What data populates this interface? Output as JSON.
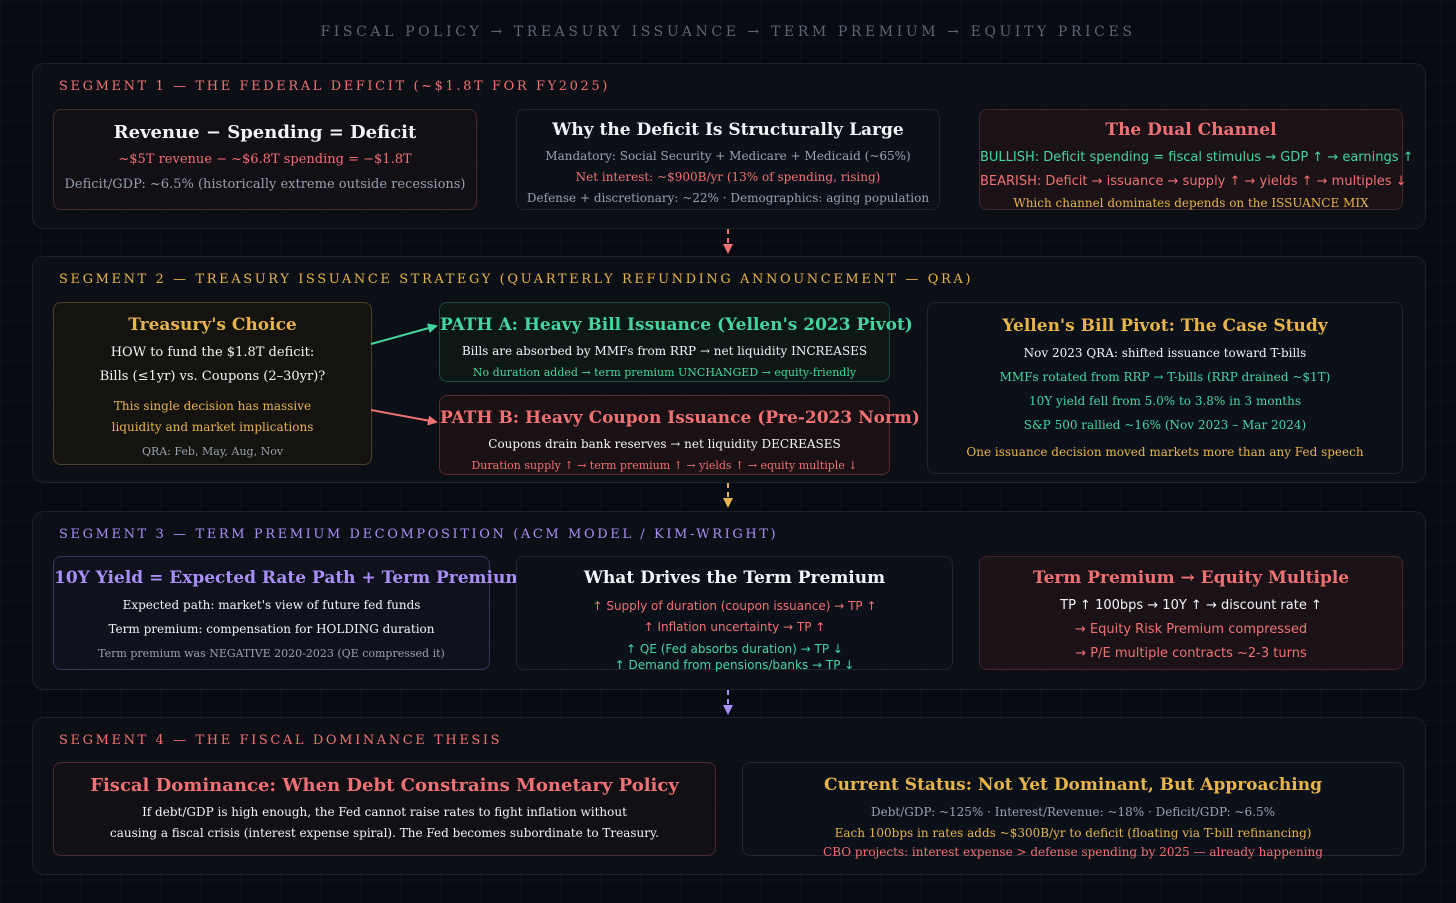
{
  "title": "FISCAL POLICY → TREASURY ISSUANCE → TERM PREMIUM → EQUITY PRICES",
  "colors": {
    "background": "#080b11",
    "red": "#f07174",
    "green": "#45d6a0",
    "gold": "#e7b44b",
    "purple": "#a98ff5",
    "gray": "#97a1af",
    "white": "#f2f4f7"
  },
  "segment1": {
    "label": "SEGMENT 1 — THE FEDERAL DEFICIT (~$1.8T FOR FY2025)",
    "equation": {
      "title": "Revenue − Spending = Deficit",
      "line1": "~$5T revenue − ~$6.8T spending = −$1.8T",
      "line2": "Deficit/GDP: ~6.5% (historically extreme outside recessions)"
    },
    "structural": {
      "title": "Why the Deficit Is Structurally Large",
      "line1": "Mandatory: Social Security + Medicare + Medicaid (~65%)",
      "line2": "Net interest: ~$900B/yr (13% of spending, rising)",
      "line3": "Defense + discretionary: ~22% · Demographics: aging population"
    },
    "dual": {
      "title": "The Dual Channel",
      "bullish": "BULLISH: Deficit spending = fiscal stimulus → GDP ↑ → earnings ↑",
      "bearish": "BEARISH: Deficit → issuance → supply ↑ → yields ↑ → multiples ↓",
      "note": "Which channel dominates depends on the ISSUANCE MIX"
    }
  },
  "segment2": {
    "label": "SEGMENT 2 — TREASURY ISSUANCE STRATEGY (QUARTERLY REFUNDING ANNOUNCEMENT — QRA)",
    "choice": {
      "title": "Treasury's Choice",
      "line1": "HOW to fund the $1.8T deficit:",
      "line2": "Bills (≤1yr) vs. Coupons (2–30yr)?",
      "line3": "This single decision has massive",
      "line4": "liquidity and market implications",
      "line5": "QRA: Feb, May, Aug, Nov"
    },
    "pathA": {
      "title": "PATH A: Heavy Bill Issuance (Yellen's 2023 Pivot)",
      "line1": "Bills are absorbed by MMFs from RRP → net liquidity INCREASES",
      "line2": "No duration added → term premium UNCHANGED → equity-friendly"
    },
    "pathB": {
      "title": "PATH B: Heavy Coupon Issuance (Pre-2023 Norm)",
      "line1": "Coupons drain bank reserves → net liquidity DECREASES",
      "line2": "Duration supply ↑ → term premium ↑ → yields ↑ → equity multiple ↓"
    },
    "case": {
      "title": "Yellen's Bill Pivot: The Case Study",
      "line1": "Nov 2023 QRA: shifted issuance toward T-bills",
      "line2": "MMFs rotated from RRP → T-bills (RRP drained ~$1T)",
      "line3": "10Y yield fell from 5.0% to 3.8% in 3 months",
      "line4": "S&P 500 rallied ~16% (Nov 2023 – Mar 2024)",
      "line5": "One issuance decision moved markets more than any Fed speech"
    }
  },
  "segment3": {
    "label": "SEGMENT 3 — TERM PREMIUM DECOMPOSITION (ACM MODEL / KIM-WRIGHT)",
    "yield": {
      "title": "10Y Yield = Expected Rate Path + Term Premium",
      "line1": "Expected path: market's view of future fed funds",
      "line2": "Term premium: compensation for HOLDING duration",
      "line3": "Term premium was NEGATIVE 2020-2023 (QE compressed it)"
    },
    "drivers": {
      "title": "What Drives the Term Premium",
      "line1": "↑ Supply of duration (coupon issuance) → TP ↑",
      "line2": "↑ Inflation uncertainty → TP ↑",
      "line3": "↑ QE (Fed absorbs duration) → TP ↓",
      "line4": "↑ Demand from pensions/banks → TP ↓"
    },
    "equity": {
      "title": "Term Premium → Equity Multiple",
      "line1": "TP ↑ 100bps → 10Y ↑ → discount rate ↑",
      "line2": "→ Equity Risk Premium compressed",
      "line3": "→ P/E multiple contracts ~2-3 turns"
    }
  },
  "segment4": {
    "label": "SEGMENT 4 — THE FISCAL DOMINANCE THESIS",
    "dominance": {
      "title": "Fiscal Dominance: When Debt Constrains Monetary Policy",
      "line1": "If debt/GDP is high enough, the Fed cannot raise rates to fight inflation without",
      "line2": "causing a fiscal crisis (interest expense spiral). The Fed becomes subordinate to Treasury."
    },
    "status": {
      "title": "Current Status: Not Yet Dominant, But Approaching",
      "line1": "Debt/GDP: ~125% · Interest/Revenue: ~18% · Deficit/GDP: ~6.5%",
      "line2": "Each 100bps in rates adds ~$300B/yr to deficit (floating via T-bill refinancing)",
      "line3": "CBO projects: interest expense > defense spending by 2025 — already happening"
    }
  }
}
